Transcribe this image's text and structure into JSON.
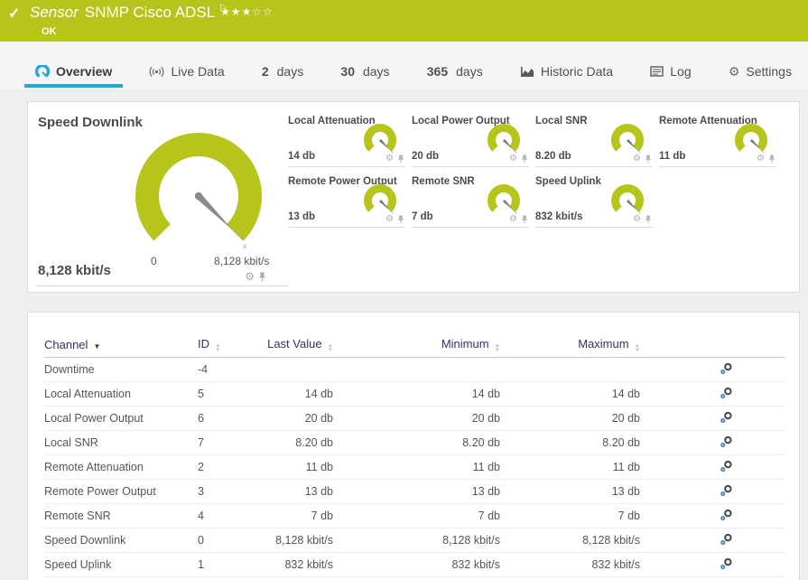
{
  "colors": {
    "brand_green": "#b6c41c",
    "accent_blue": "#29a3da",
    "header_purple": "#3b2f68"
  },
  "header": {
    "kind": "Sensor",
    "title": "SNMP Cisco ADSL",
    "status": "OK",
    "rating": {
      "filled": 3,
      "total": 5,
      "display": "★★★☆☆"
    }
  },
  "tabs": {
    "overview": "Overview",
    "live_data": "Live Data",
    "days2_num": "2",
    "days2_label": "days",
    "days30_num": "30",
    "days30_label": "days",
    "days365_num": "365",
    "days365_label": "days",
    "historic": "Historic Data",
    "log": "Log",
    "settings": "Settings"
  },
  "main_gauge": {
    "title": "Speed Downlink",
    "value": "8,128 kbit/s",
    "scale_min": "0",
    "scale_max": "8,128 kbit/s"
  },
  "mini_gauges": [
    {
      "title": "Local Attenuation",
      "value": "14 db"
    },
    {
      "title": "Local Power Output",
      "value": "20 db"
    },
    {
      "title": "Local SNR",
      "value": "8.20 db"
    },
    {
      "title": "Remote Attenuation",
      "value": "11 db"
    },
    {
      "title": "Remote Power Output",
      "value": "13 db"
    },
    {
      "title": "Remote SNR",
      "value": "7 db"
    },
    {
      "title": "Speed Uplink",
      "value": "832 kbit/s"
    }
  ],
  "table": {
    "headers": {
      "channel": "Channel",
      "id": "ID",
      "last": "Last Value",
      "min": "Minimum",
      "max": "Maximum"
    },
    "rows": [
      {
        "channel": "Downtime",
        "id": "-4",
        "last": "",
        "min": "",
        "max": ""
      },
      {
        "channel": "Local Attenuation",
        "id": "5",
        "last": "14 db",
        "min": "14 db",
        "max": "14 db"
      },
      {
        "channel": "Local Power Output",
        "id": "6",
        "last": "20 db",
        "min": "20 db",
        "max": "20 db"
      },
      {
        "channel": "Local SNR",
        "id": "7",
        "last": "8.20 db",
        "min": "8.20 db",
        "max": "8.20 db"
      },
      {
        "channel": "Remote Attenuation",
        "id": "2",
        "last": "11 db",
        "min": "11 db",
        "max": "11 db"
      },
      {
        "channel": "Remote Power Output",
        "id": "3",
        "last": "13 db",
        "min": "13 db",
        "max": "13 db"
      },
      {
        "channel": "Remote SNR",
        "id": "4",
        "last": "7 db",
        "min": "7 db",
        "max": "7 db"
      },
      {
        "channel": "Speed Downlink",
        "id": "0",
        "last": "8,128 kbit/s",
        "min": "8,128 kbit/s",
        "max": "8,128 kbit/s"
      },
      {
        "channel": "Speed Uplink",
        "id": "1",
        "last": "832 kbit/s",
        "min": "832 kbit/s",
        "max": "832 kbit/s"
      }
    ]
  }
}
